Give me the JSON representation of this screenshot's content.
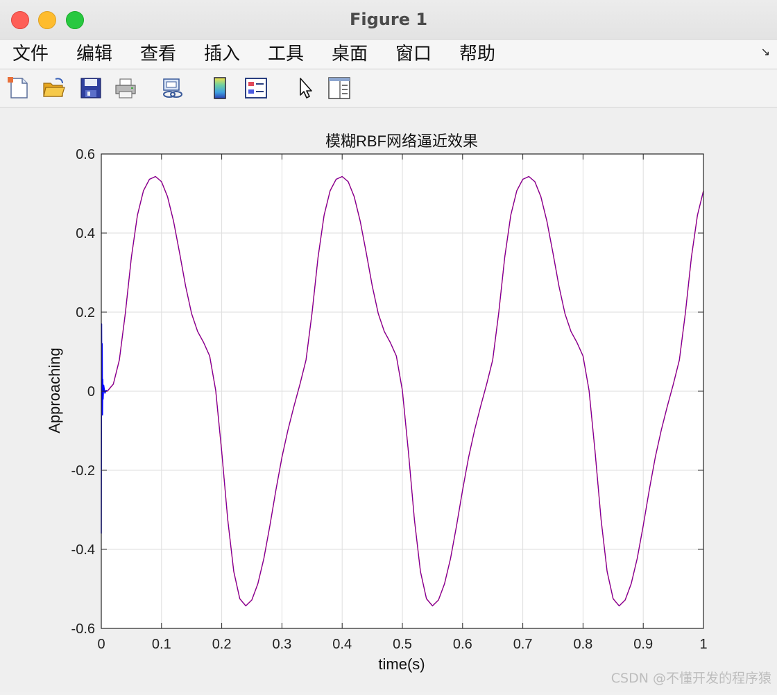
{
  "window": {
    "title": "Figure 1"
  },
  "menu": {
    "items": [
      "文件",
      "编辑",
      "查看",
      "插入",
      "工具",
      "桌面",
      "窗口",
      "帮助"
    ],
    "corner_icon": "↘"
  },
  "toolbar": {
    "tools": [
      "new-figure-icon",
      "open-file-icon",
      "save-icon",
      "print-icon",
      "link-plot-icon",
      "colorbar-icon",
      "legend-icon",
      "pointer-icon",
      "property-inspector-icon"
    ]
  },
  "chart_data": {
    "type": "line",
    "title": "模糊RBF网络逼近效果",
    "xlabel": "time(s)",
    "ylabel": "Approaching",
    "xlim": [
      0,
      1
    ],
    "ylim": [
      -0.6,
      0.6
    ],
    "xticks": [
      0,
      0.1,
      0.2,
      0.3,
      0.4,
      0.5,
      0.6,
      0.7,
      0.8,
      0.9,
      1
    ],
    "xtick_labels": [
      "0",
      "0.1",
      "0.2",
      "0.3",
      "0.4",
      "0.5",
      "0.6",
      "0.7",
      "0.8",
      "0.9",
      "1"
    ],
    "yticks": [
      -0.6,
      -0.4,
      -0.2,
      0,
      0.2,
      0.4,
      0.6
    ],
    "ytick_labels": [
      "-0.6",
      "-0.4",
      "-0.2",
      "0",
      "0.2",
      "0.4",
      "0.6"
    ],
    "grid": true,
    "series": [
      {
        "color": "#ff0000",
        "x": [
          0,
          0.01,
          0.02,
          0.03,
          0.04,
          0.05,
          0.06,
          0.07,
          0.08,
          0.09,
          0.1,
          0.11,
          0.12,
          0.13,
          0.14,
          0.15,
          0.16,
          0.17,
          0.18,
          0.19,
          0.2,
          0.21,
          0.22,
          0.23,
          0.24,
          0.25,
          0.26,
          0.27,
          0.28,
          0.29,
          0.3,
          0.31,
          0.32,
          0.33,
          0.34,
          0.35,
          0.36,
          0.37,
          0.38,
          0.39,
          0.4,
          0.41,
          0.42,
          0.43,
          0.44,
          0.45,
          0.46,
          0.47,
          0.48,
          0.49,
          0.5,
          0.51,
          0.52,
          0.53,
          0.54,
          0.55,
          0.56,
          0.57,
          0.58,
          0.59,
          0.6,
          0.61,
          0.62,
          0.63,
          0.64,
          0.65,
          0.66,
          0.67,
          0.68,
          0.69,
          0.7,
          0.71,
          0.72,
          0.73,
          0.74,
          0.75,
          0.76,
          0.77,
          0.78,
          0.79,
          0.8,
          0.81,
          0.82,
          0.83,
          0.84,
          0.85,
          0.86,
          0.87,
          0.88,
          0.89,
          0.9,
          0.91,
          0.92,
          0.93,
          0.94,
          0.95,
          0.96,
          0.97,
          0.98,
          0.99,
          1.0
        ],
        "y": [
          0,
          0.0,
          0.018,
          0.079,
          0.198,
          0.339,
          0.445,
          0.507,
          0.536,
          0.543,
          0.53,
          0.492,
          0.43,
          0.35,
          0.266,
          0.196,
          0.151,
          0.123,
          0.089,
          0.002,
          -0.153,
          -0.325,
          -0.456,
          -0.525,
          -0.543,
          -0.528,
          -0.487,
          -0.423,
          -0.34,
          -0.25,
          -0.167,
          -0.098,
          -0.038,
          0.018,
          0.079,
          0.198,
          0.339,
          0.445,
          0.507,
          0.536,
          0.543,
          0.53,
          0.492,
          0.43,
          0.35,
          0.266,
          0.196,
          0.151,
          0.123,
          0.089,
          0.002,
          -0.153,
          -0.325,
          -0.456,
          -0.525,
          -0.543,
          -0.528,
          -0.487,
          -0.423,
          -0.34,
          -0.25,
          -0.167,
          -0.098,
          -0.038,
          0.018,
          0.079,
          0.198,
          0.339,
          0.445,
          0.507,
          0.536,
          0.543,
          0.53,
          0.492,
          0.43,
          0.35,
          0.266,
          0.196,
          0.151,
          0.123,
          0.089,
          0.002,
          -0.153,
          -0.325,
          -0.456,
          -0.525,
          -0.543,
          -0.528,
          -0.487,
          -0.423,
          -0.34,
          -0.25,
          -0.167,
          -0.098,
          -0.038,
          0.018,
          0.079,
          0.198,
          0.339,
          0.445,
          0.507
        ]
      },
      {
        "color": "#0000ff",
        "x": [
          0,
          0.0005,
          0.001,
          0.0015,
          0.002,
          0.0025,
          0.003,
          0.004,
          0.006,
          0.008,
          0.01
        ],
        "y": [
          -0.36,
          0.17,
          -0.05,
          0.12,
          -0.06,
          0.03,
          -0.02,
          0.015,
          -0.005,
          0.002,
          0.0
        ]
      }
    ]
  },
  "watermark": "CSDN @不懂开发的程序猿"
}
